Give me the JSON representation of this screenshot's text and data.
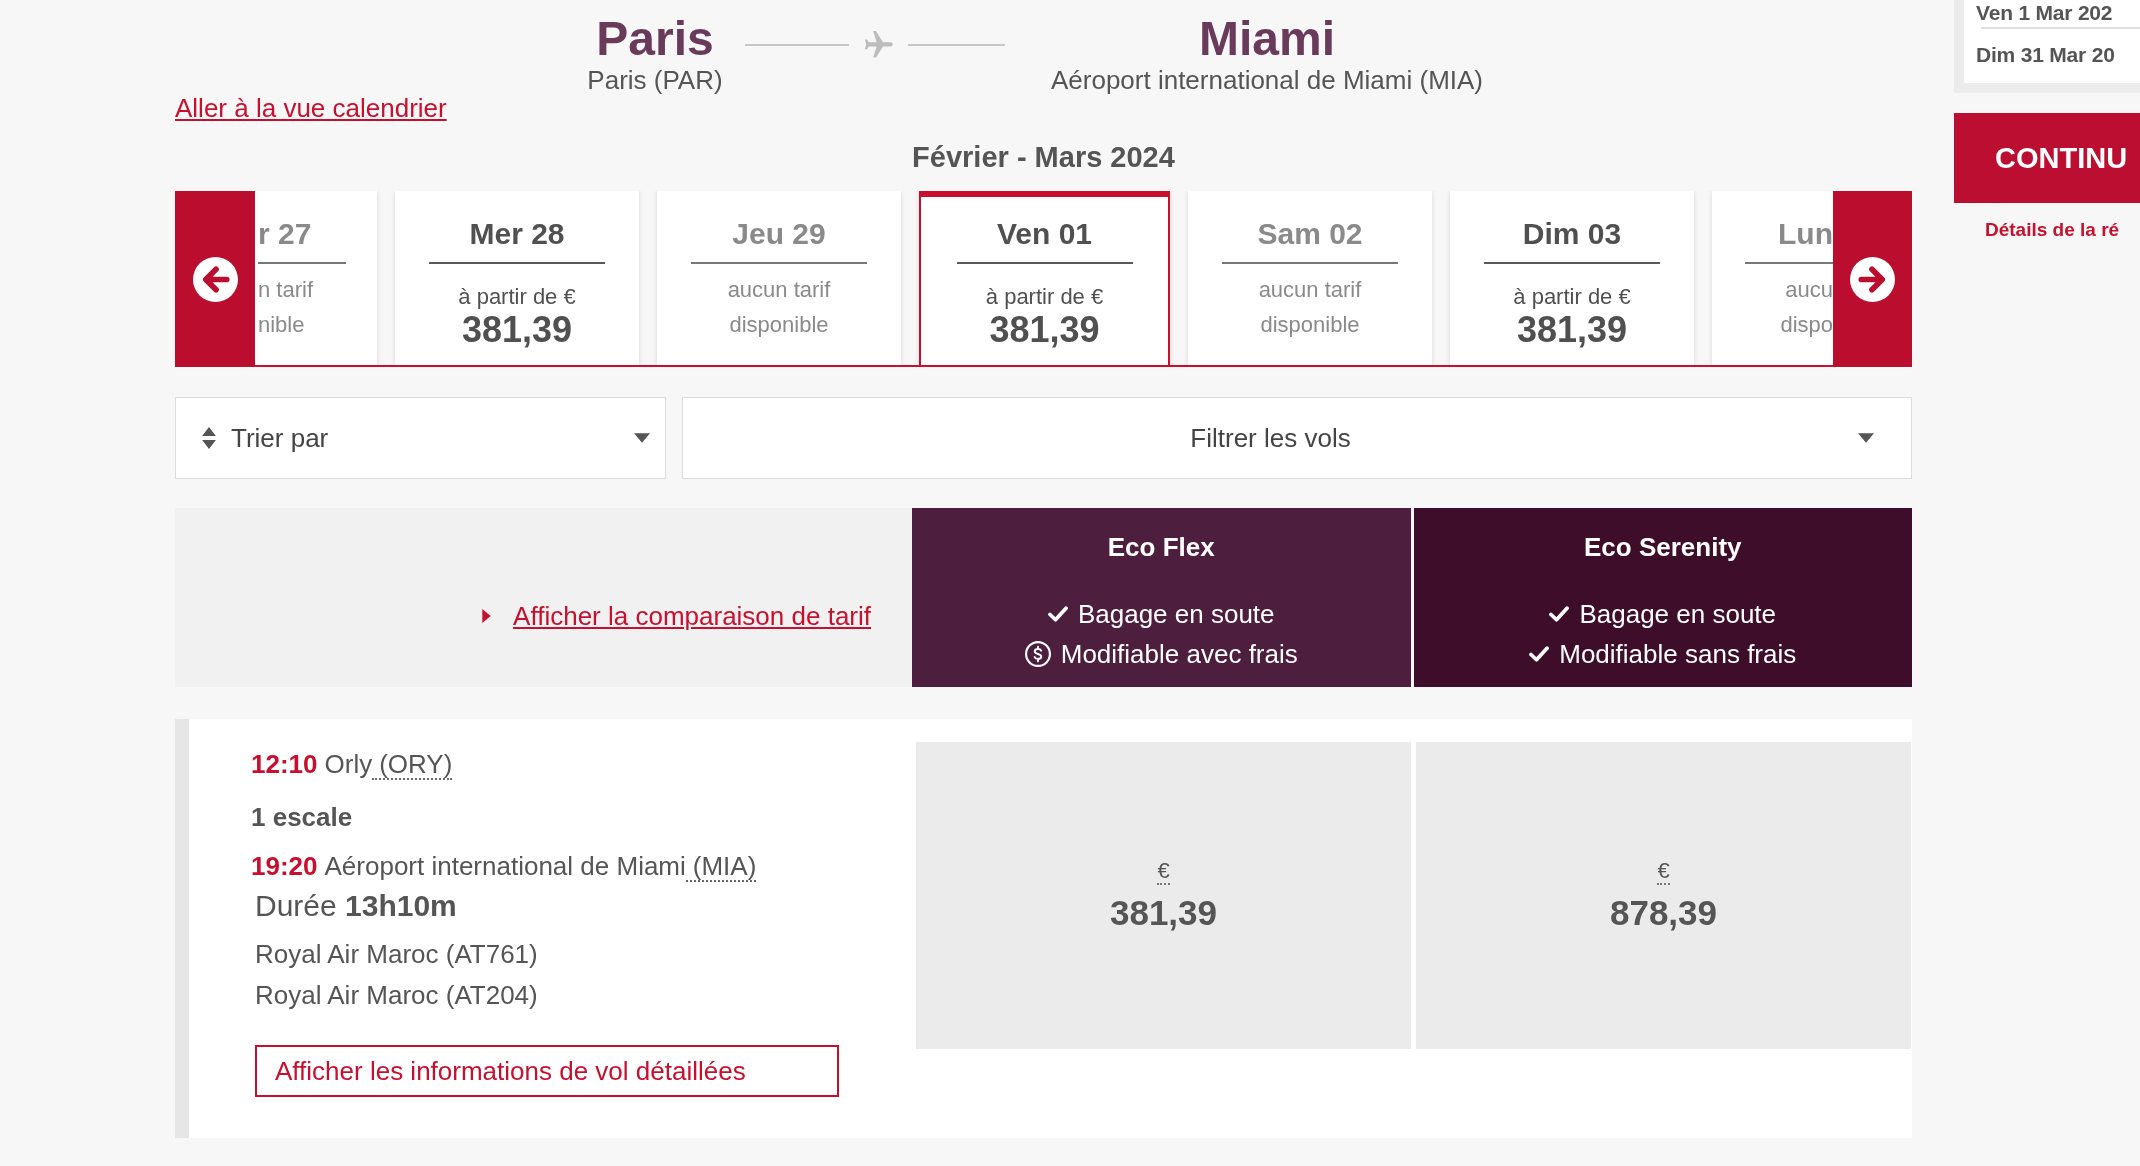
{
  "header": {
    "calendar_link": "Aller à la vue calendrier",
    "origin": {
      "city": "Paris",
      "airport": "Paris (PAR)"
    },
    "destination": {
      "city": "Miami",
      "airport": "Aéroport international de Miami (MIA)"
    },
    "period": "Février - Mars 2024"
  },
  "date_carousel": {
    "dates": [
      {
        "kind": "no_fare",
        "partial": true,
        "day": "r 27",
        "note": "n tarif nible",
        "selected": false
      },
      {
        "kind": "fare",
        "partial": false,
        "day": "Mer 28",
        "from": "à partir de €",
        "price": "381,39",
        "selected": false
      },
      {
        "kind": "no_fare",
        "partial": false,
        "day": "Jeu 29",
        "note": "aucun tarif disponible",
        "selected": false
      },
      {
        "kind": "fare",
        "partial": false,
        "day": "Ven 01",
        "from": "à partir de €",
        "price": "381,39",
        "selected": true
      },
      {
        "kind": "no_fare",
        "partial": false,
        "day": "Sam 02",
        "note": "aucun tarif disponible",
        "selected": false
      },
      {
        "kind": "fare",
        "partial": false,
        "day": "Dim 03",
        "from": "à partir de €",
        "price": "381,39",
        "selected": false
      },
      {
        "kind": "no_fare",
        "partial": true,
        "day": "Lun",
        "note": "aucu dispo",
        "selected": false
      }
    ]
  },
  "sort": {
    "label": "Trier par"
  },
  "filter": {
    "label": "Filtrer les vols"
  },
  "fare_comparison_link": "Afficher la comparaison de tarif",
  "fare_families": [
    {
      "name": "Eco Flex",
      "color": "#4e1e3e",
      "features": [
        {
          "kind": "included",
          "text": "Bagage en soute"
        },
        {
          "kind": "fee",
          "text": "Modifiable avec frais"
        }
      ]
    },
    {
      "name": "Eco Serenity",
      "color": "#3d0d2a",
      "features": [
        {
          "kind": "included",
          "text": "Bagage en soute"
        },
        {
          "kind": "included",
          "text": "Modifiable sans frais"
        }
      ]
    }
  ],
  "flights": [
    {
      "departure": {
        "time": "12:10",
        "airport": "Orly",
        "code": "(ORY)"
      },
      "stops": "1 escale",
      "arrival": {
        "time": "19:20",
        "airport": "Aéroport international de Miami",
        "code": "(MIA)"
      },
      "duration": "Durée **13h10m**",
      "carriers": [
        "Royal Air Maroc (AT761)",
        "Royal Air Maroc (AT204)"
      ],
      "details_button": "Afficher les informations de vol détaillées",
      "fares": [
        {
          "currency": "€",
          "price": "381,39"
        },
        {
          "currency": "€",
          "price": "878,39"
        }
      ]
    }
  ],
  "trip_summary": {
    "dates": [
      "Ven 1 Mar 202",
      "Dim 31 Mar 20"
    ]
  },
  "continue_button": "CONTINU",
  "booking_details_link": "Détails de la ré"
}
